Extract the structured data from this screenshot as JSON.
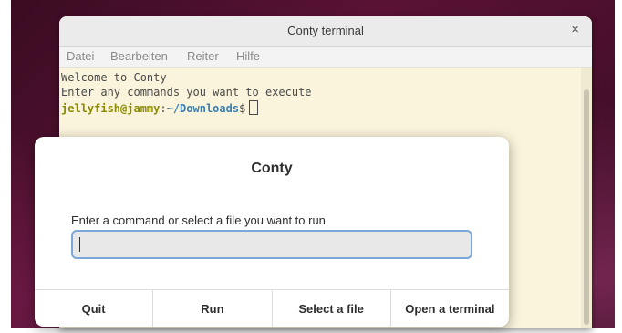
{
  "terminal": {
    "title": "Conty terminal",
    "close_glyph": "×",
    "menu": [
      "Datei",
      "Bearbeiten",
      "Reiter",
      "Hilfe"
    ],
    "lines": [
      "Welcome to Conty",
      "Enter any commands you want to execute"
    ],
    "prompt": {
      "user_host": "jellyfish@jammy",
      "colon": ":",
      "path": "~/Downloads",
      "dollar": "$"
    }
  },
  "dialog": {
    "title": "Conty",
    "label": "Enter a command or select a file you want to run",
    "input_value": "",
    "buttons": {
      "quit": "Quit",
      "run": "Run",
      "select_file": "Select a file",
      "open_terminal": "Open a terminal"
    }
  },
  "colors": {
    "terminal_bg": "#fbf4dc",
    "prompt_user": "#8a8a00",
    "prompt_path": "#3a7fb0",
    "input_focus_border": "#7da7d9"
  }
}
